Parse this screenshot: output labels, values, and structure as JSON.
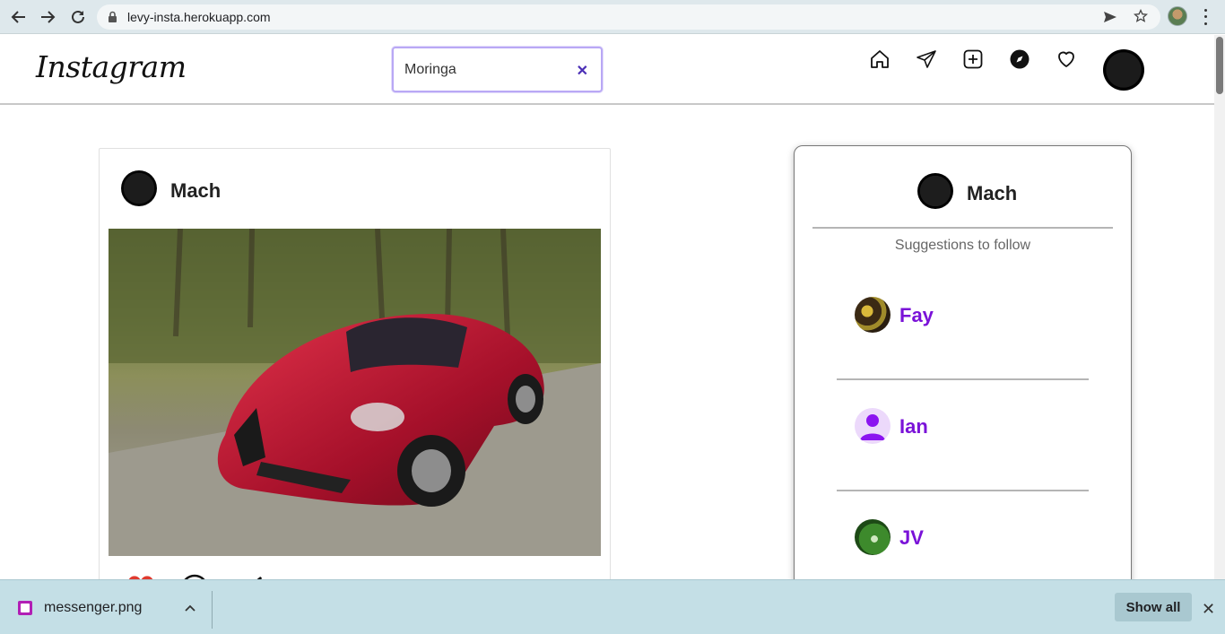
{
  "browser": {
    "url": "levy-insta.herokuapp.com",
    "icons": [
      "back-icon",
      "forward-icon",
      "reload-icon",
      "lock-icon",
      "send-icon",
      "star-icon",
      "kebab-menu-icon"
    ]
  },
  "header": {
    "logo": "Instagram",
    "search": {
      "value": "Moringa",
      "clear": "✕"
    },
    "nav_icons": [
      "home-icon",
      "send-icon",
      "add-post-icon",
      "explore-icon",
      "heart-icon"
    ]
  },
  "post": {
    "username": "Mach",
    "image": "red sports car on road",
    "actions": [
      "heart-icon",
      "comment-icon",
      "share-icon"
    ]
  },
  "sidebar": {
    "username": "Mach",
    "subtitle": "Suggestions to follow",
    "suggestions": [
      {
        "name": "Fay"
      },
      {
        "name": "Ian"
      },
      {
        "name": "JV"
      }
    ]
  },
  "downloads": {
    "file": "messenger.png",
    "show_all": "Show all",
    "close": "✕"
  },
  "colors": {
    "accent": "#7a12d8",
    "search_border": "#b9a8f5",
    "download_bar": "#c4dfe6"
  }
}
